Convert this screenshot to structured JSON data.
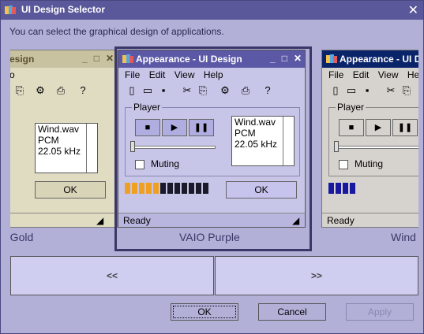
{
  "dialog": {
    "title": "UI Design Selector",
    "close": "✕",
    "description": "You can select the graphical design of applications."
  },
  "previews": [
    {
      "name": "left",
      "title_visible": "esign",
      "label": "e Gold",
      "menu": [
        "o"
      ],
      "list": [
        "Wind.wav",
        "PCM",
        "22.05 kHz"
      ],
      "ok": "OK"
    },
    {
      "name": "center",
      "title": "Appearance - UI Design",
      "label": "VAIO Purple",
      "menu": [
        "File",
        "Edit",
        "View",
        "Help"
      ],
      "group_label": "Player",
      "list": [
        "Wind.wav",
        "PCM",
        "22.05 kHz"
      ],
      "muting": "Muting",
      "ok": "OK",
      "status": "Ready",
      "meter_level": 0.45
    },
    {
      "name": "right",
      "title": "Appearance - UI De",
      "label": "Wind",
      "menu": [
        "File",
        "Edit",
        "View",
        "Help"
      ],
      "group_label": "Player",
      "muting": "Muting",
      "status": "Ready",
      "meter_level": 0.35
    }
  ],
  "navigation": {
    "prev": "<<",
    "next": ">>"
  },
  "buttons": {
    "ok": "OK",
    "cancel": "Cancel",
    "apply": "Apply"
  },
  "colors": {
    "accent": "#5a579a",
    "background": "#b3b0d8"
  }
}
